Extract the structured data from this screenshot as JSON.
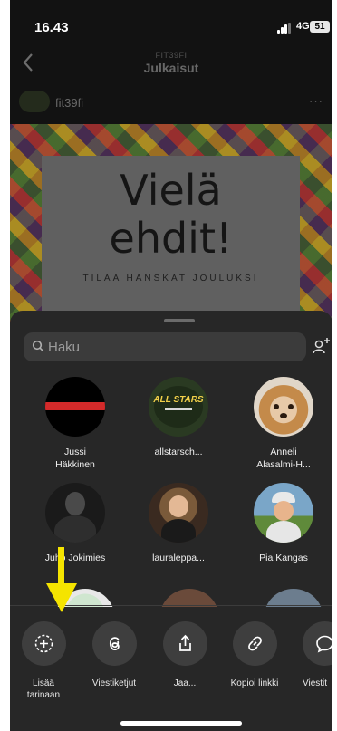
{
  "status_bar": {
    "time": "16.43",
    "network": "4G",
    "battery": "51"
  },
  "header": {
    "subtitle": "FIT39FI",
    "title": "Julkaisut"
  },
  "post": {
    "username": "fit39fi",
    "more": "···",
    "line1": "Vielä",
    "line2": "ehdit!",
    "tagline": "TILAA HANSKAT JOULUKSI"
  },
  "share_sheet": {
    "search": {
      "placeholder": "Haku",
      "value": ""
    },
    "contacts": [
      {
        "name_line1": "Jussi",
        "name_line2": "Häkkinen"
      },
      {
        "name_line1": "allstarsch...",
        "name_line2": "",
        "avatar_text": "ALL STARS"
      },
      {
        "name_line1": "Anneli",
        "name_line2": "Alasalmi-H..."
      },
      {
        "name_line1": "Juho Jokimies",
        "name_line2": ""
      },
      {
        "name_line1": "lauraleppa...",
        "name_line2": ""
      },
      {
        "name_line1": "Pia Kangas",
        "name_line2": ""
      }
    ],
    "actions": [
      {
        "label_line1": "Lisää",
        "label_line2": "tarinaan",
        "icon": "add-story-icon"
      },
      {
        "label_line1": "Viestiketjut",
        "label_line2": "",
        "icon": "threads-icon"
      },
      {
        "label_line1": "Jaa...",
        "label_line2": "",
        "icon": "share-icon"
      },
      {
        "label_line1": "Kopioi linkki",
        "label_line2": "",
        "icon": "link-icon"
      },
      {
        "label_line1": "Viestit",
        "label_line2": "",
        "icon": "message-icon"
      }
    ]
  },
  "colors": {
    "sheet_bg": "#272727",
    "arrow": "#f5e400",
    "background": "#121212"
  }
}
